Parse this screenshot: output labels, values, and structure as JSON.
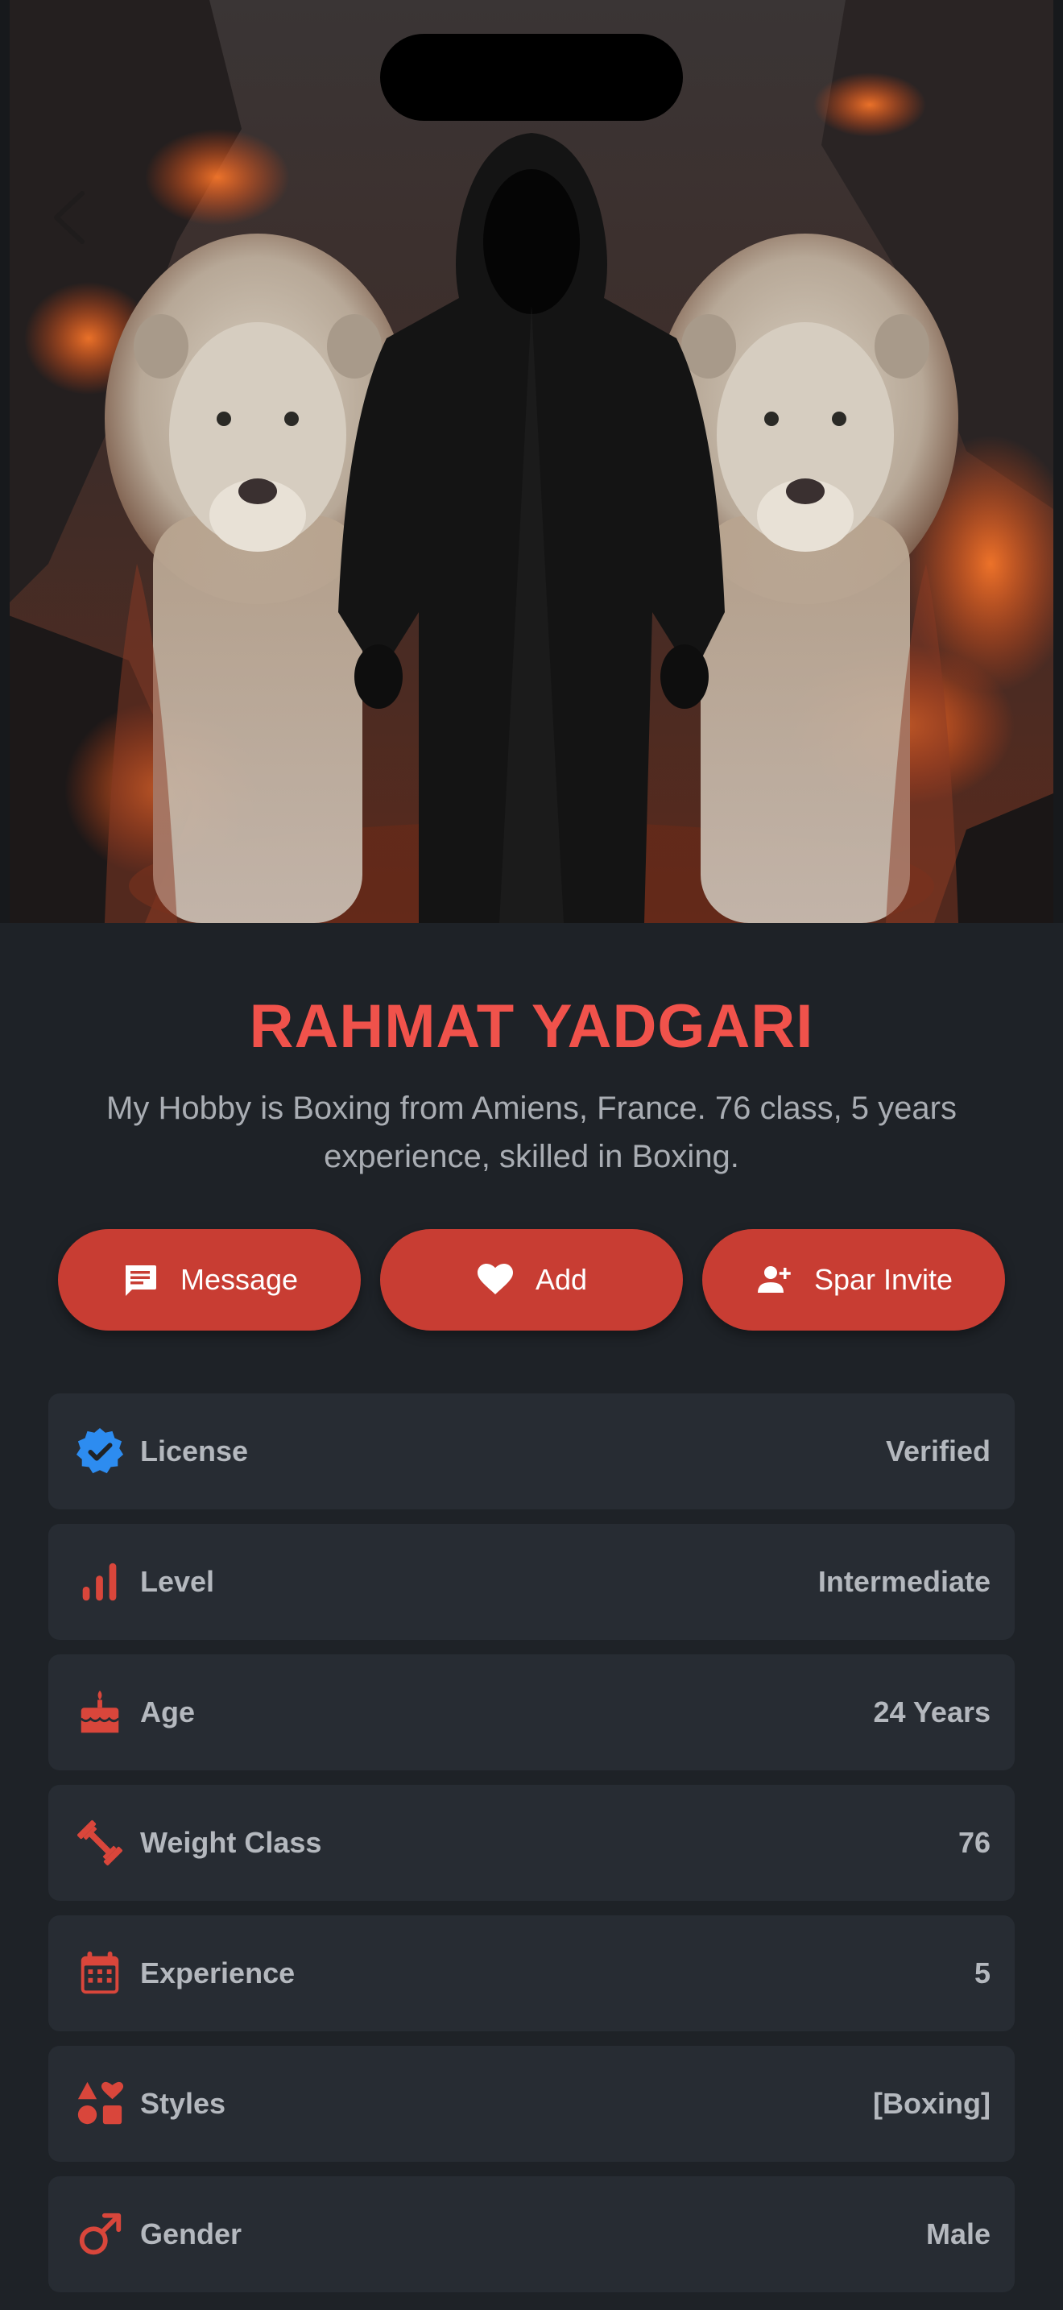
{
  "profile": {
    "name": "RAHMAT YADGARI",
    "bio": "My Hobby is Boxing  from Amiens, France. 76 class, 5 years experience, skilled in Boxing."
  },
  "actions": [
    {
      "label": "Message",
      "icon": "message-icon"
    },
    {
      "label": "Add",
      "icon": "heart-icon"
    },
    {
      "label": "Spar Invite",
      "icon": "person-add-icon"
    }
  ],
  "details": [
    {
      "label": "License",
      "value": "Verified",
      "icon": "verified-badge-icon"
    },
    {
      "label": "Level",
      "value": "Intermediate",
      "icon": "bar-chart-icon"
    },
    {
      "label": "Age",
      "value": "24 Years",
      "icon": "birthday-cake-icon"
    },
    {
      "label": "Weight Class",
      "value": "76",
      "icon": "dumbbell-icon"
    },
    {
      "label": "Experience",
      "value": "5",
      "icon": "calendar-icon"
    },
    {
      "label": "Styles",
      "value": "[Boxing]",
      "icon": "shapes-icon"
    },
    {
      "label": "Gender",
      "value": "Male",
      "icon": "male-icon"
    }
  ],
  "colors": {
    "accent": "#c83d33",
    "name": "#f0524b",
    "background": "#1e2227",
    "card": "#272c33",
    "verified": "#2d8cf0"
  }
}
